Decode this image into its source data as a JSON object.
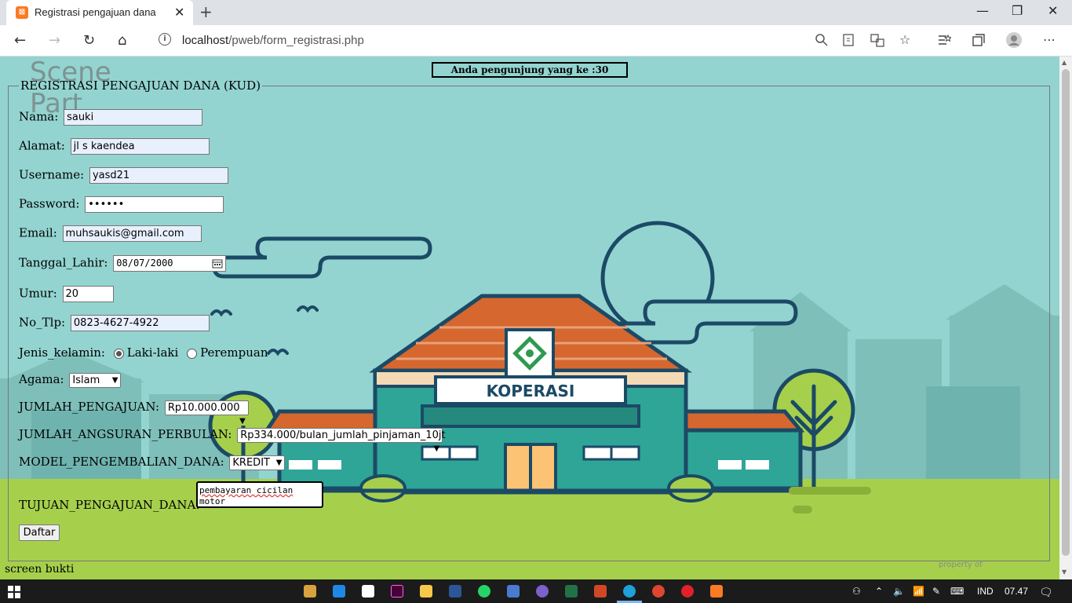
{
  "browser": {
    "tab_title": "Registrasi pengajuan dana",
    "tab_close": "✕",
    "new_tab": "+",
    "url_host": "localhost",
    "url_path": "/pweb/form_registrasi.php",
    "back": "←",
    "forward": "→",
    "reload": "↻",
    "home": "⌂",
    "favorite": "☆",
    "more": "⋯",
    "minimize": "—",
    "restore": "❐",
    "close": "✕"
  },
  "page": {
    "visitor_text": "Anda pengunjung yang ke :30",
    "scene_line1": "Scene",
    "scene_line2": "Part",
    "legend": "REGISTRASI PENGAJUAN DANA (KUD)",
    "koperasi_sign": "KOPERASI",
    "form": {
      "nama_label": "Nama:",
      "nama_value": "sauki",
      "alamat_label": "Alamat:",
      "alamat_value": "jl s kaendea",
      "username_label": "Username:",
      "username_value": "yasd21",
      "password_label": "Password:",
      "password_value": "••••••",
      "email_label": "Email:",
      "email_value": "muhsaukis@gmail.com",
      "tanggal_label": "Tanggal_Lahir:",
      "tanggal_value": "08/07/2000",
      "umur_label": "Umur:",
      "umur_value": "20",
      "notlp_label": "No_Tlp:",
      "notlp_value": "0823-4627-4922",
      "jk_label": "Jenis_kelamin:",
      "jk_opt1": "Laki-laki",
      "jk_opt2": "Perempuan",
      "agama_label": "Agama:",
      "agama_value": "Islam",
      "jumlah_label": "JUMLAH_PENGAJUAN:",
      "jumlah_value": "Rp10.000.000",
      "angsuran_label": "JUMLAH_ANGSURAN_PERBULAN:",
      "angsuran_value": "Rp334.000/bulan_jumlah_pinjaman_10jt",
      "model_label": "MODEL_PENGEMBALIAN_DANA:",
      "model_value": "KREDIT",
      "tujuan_label": "TUJUAN_PENGAJUAN_DANA:",
      "tujuan_line1": "pembayaran cicilan",
      "tujuan_line2": "motor",
      "submit": "Daftar"
    },
    "footer_text": "screen bukti",
    "property_text": "property of"
  },
  "taskbar": {
    "lang": "IND",
    "time": "07.47"
  },
  "colors": {
    "sky": "#93d4d0",
    "grass": "#a6d04c",
    "roof": "#d6672e",
    "building": "#2ea597",
    "outline": "#1b4a66"
  }
}
